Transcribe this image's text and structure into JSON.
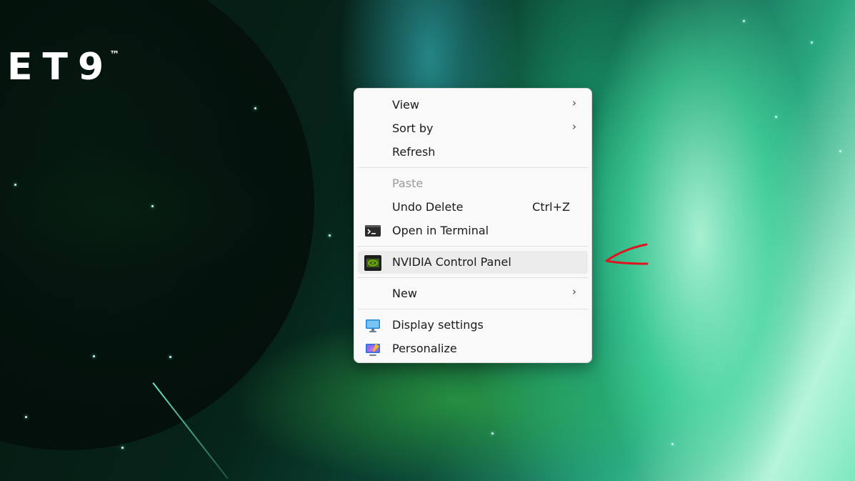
{
  "desktop": {
    "logo_text": "ET9",
    "logo_mark": "™"
  },
  "context_menu": {
    "items": [
      {
        "label": "View",
        "submenu": "›"
      },
      {
        "label": "Sort by",
        "submenu": "›"
      },
      {
        "label": "Refresh"
      },
      {
        "label": "Paste",
        "disabled": true
      },
      {
        "label": "Undo Delete",
        "shortcut": "Ctrl+Z"
      },
      {
        "label": "Open in Terminal",
        "icon": "terminal-icon"
      },
      {
        "label": "NVIDIA Control Panel",
        "icon": "nvidia-icon",
        "highlighted": true
      },
      {
        "label": "New",
        "submenu": "›"
      },
      {
        "label": "Display settings",
        "icon": "display-settings-icon"
      },
      {
        "label": "Personalize",
        "icon": "personalize-icon"
      }
    ]
  },
  "colors": {
    "menu_background": "#f9f9f9",
    "hover_background": "#ececec",
    "annotation": "#e0141e"
  }
}
